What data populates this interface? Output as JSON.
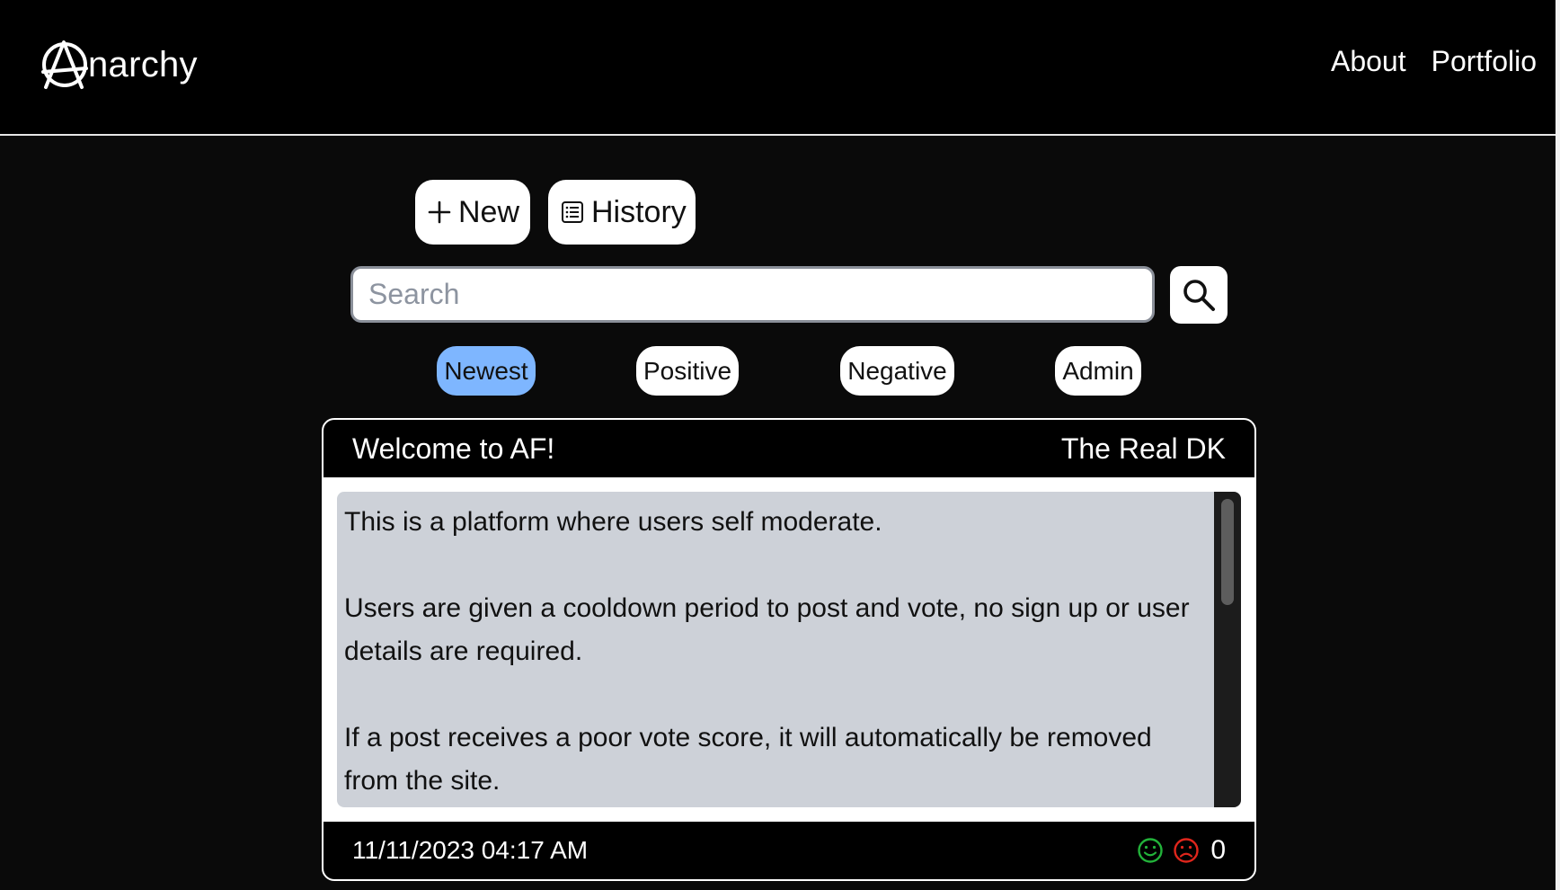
{
  "header": {
    "brand_text": "narchy",
    "nav": [
      {
        "label": "About"
      },
      {
        "label": "Portfolio"
      }
    ]
  },
  "actions": {
    "new_label": "New",
    "history_label": "History"
  },
  "search": {
    "placeholder": "Search",
    "value": ""
  },
  "filters": {
    "items": [
      {
        "label": "Newest",
        "active": true
      },
      {
        "label": "Positive",
        "active": false
      },
      {
        "label": "Negative",
        "active": false
      },
      {
        "label": "Admin",
        "active": false
      }
    ]
  },
  "post": {
    "title": "Welcome to AF!",
    "author": "The Real DK",
    "paragraphs": [
      "This is a platform where users self moderate.",
      "Users are given a cooldown period to post and vote, no sign up or user details are required.",
      "If a post receives a poor vote score, it will automatically be removed from the site."
    ],
    "timestamp": "11/11/2023 04:17 AM",
    "score": "0"
  },
  "colors": {
    "active_filter": "#7eb6ff",
    "upvote": "#22b33a",
    "downvote": "#e0261c",
    "post_body_bg": "#cdd1d8"
  },
  "icons": {
    "logo": "anarchy-a-icon",
    "new": "plus-icon",
    "history": "list-icon",
    "search": "magnifier-icon",
    "upvote": "smiley-icon",
    "downvote": "frown-icon"
  }
}
